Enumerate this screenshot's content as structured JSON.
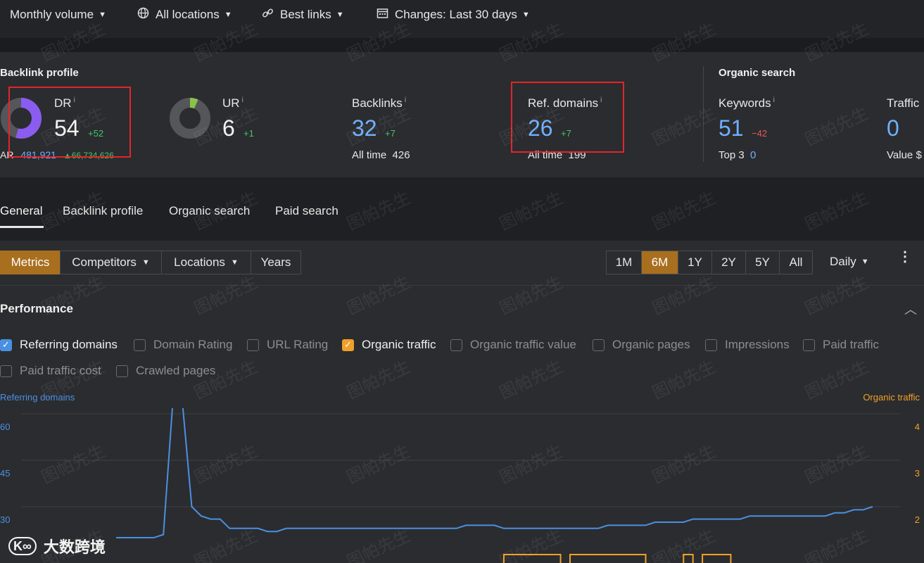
{
  "topbar": {
    "items": [
      {
        "label": "Monthly volume",
        "icon": ""
      },
      {
        "label": "All locations",
        "icon": "globe-icon"
      },
      {
        "label": "Best links",
        "icon": "link-icon"
      },
      {
        "label": "Changes: Last 30 days",
        "icon": "calendar-icon"
      }
    ]
  },
  "backlink_profile": {
    "title": "Backlink profile",
    "dr": {
      "label": "DR",
      "value": "54",
      "delta": "+52",
      "ar_label": "AR",
      "ar_value": "481,921",
      "ar_delta": "▲66,734,626"
    },
    "ur": {
      "label": "UR",
      "value": "6",
      "delta": "+1"
    },
    "backlinks": {
      "label": "Backlinks",
      "value": "32",
      "delta": "+7",
      "sub_label": "All time",
      "sub_value": "426"
    },
    "ref_domains": {
      "label": "Ref. domains",
      "value": "26",
      "delta": "+7",
      "sub_label": "All time",
      "sub_value": "199"
    }
  },
  "organic_search": {
    "title": "Organic search",
    "keywords": {
      "label": "Keywords",
      "value": "51",
      "delta": "−42",
      "sub_label": "Top 3",
      "sub_value": "0"
    },
    "traffic": {
      "label": "Traffic",
      "value": "0",
      "sub_label": "Value",
      "sub_value": "$"
    }
  },
  "tabs": [
    "General",
    "Backlink profile",
    "Organic search",
    "Paid search"
  ],
  "controls": {
    "metrics": "Metrics",
    "competitors": "Competitors",
    "locations": "Locations",
    "years": "Years",
    "ranges": [
      "1M",
      "6M",
      "1Y",
      "2Y",
      "5Y",
      "All"
    ],
    "active_range": "6M",
    "interval": "Daily"
  },
  "performance": {
    "title": "Performance",
    "checkboxes": [
      {
        "label": "Referring domains",
        "checked": true,
        "color": "#4a90e2"
      },
      {
        "label": "Domain Rating",
        "checked": false
      },
      {
        "label": "URL Rating",
        "checked": false
      },
      {
        "label": "Organic traffic",
        "checked": true,
        "color": "#f0a028"
      },
      {
        "label": "Organic traffic value",
        "checked": false
      },
      {
        "label": "Organic pages",
        "checked": false
      },
      {
        "label": "Impressions",
        "checked": false
      },
      {
        "label": "Paid traffic",
        "checked": false
      },
      {
        "label": "Paid traffic cost",
        "checked": false
      },
      {
        "label": "Crawled pages",
        "checked": false
      }
    ]
  },
  "chart_data": {
    "type": "line",
    "left_axis_title": "Referring domains",
    "right_axis_title": "Organic traffic",
    "left_ticks": [
      "60",
      "45",
      "30"
    ],
    "right_ticks": [
      "4",
      "3",
      "2"
    ],
    "series": [
      {
        "name": "Referring domains",
        "color": "#4a90e2",
        "values": [
          20,
          20,
          20,
          20,
          20,
          21,
          64,
          64,
          30,
          27,
          26,
          26,
          23,
          23,
          23,
          23,
          22,
          22,
          23,
          23,
          23,
          23,
          23,
          23,
          23,
          23,
          23,
          23,
          23,
          23,
          23,
          23,
          23,
          23,
          23,
          23,
          23,
          24,
          24,
          24,
          24,
          23,
          23,
          23,
          23,
          23,
          23,
          23,
          23,
          23,
          23,
          23,
          24,
          24,
          24,
          24,
          24,
          25,
          25,
          25,
          25,
          26,
          26,
          26,
          26,
          26,
          26,
          27,
          27,
          27,
          27,
          27,
          27,
          27,
          27,
          27,
          28,
          28,
          29,
          29,
          30
        ]
      },
      {
        "name": "Organic traffic",
        "color": "#f0a028",
        "values": [
          0,
          0,
          0,
          0,
          0,
          0,
          0,
          0,
          0,
          0,
          0,
          0,
          0,
          0,
          0,
          0,
          0,
          0,
          0,
          0,
          0,
          0,
          0,
          0,
          0,
          0,
          0,
          0,
          0,
          0,
          0,
          0,
          0,
          0,
          0,
          0,
          0,
          0,
          0,
          0,
          0,
          1,
          1,
          1,
          1,
          1,
          1,
          0,
          1,
          1,
          1,
          1,
          1,
          1,
          1,
          1,
          0,
          0,
          0,
          0,
          1,
          0,
          1,
          1,
          1,
          0,
          0,
          0,
          0,
          0,
          0,
          0,
          0,
          0,
          0,
          0,
          0,
          0,
          0,
          0,
          0
        ]
      }
    ],
    "left_ylim": [
      15,
      67
    ],
    "right_ylim": [
      0,
      4
    ],
    "grid": true
  },
  "watermark": "图帕先生",
  "brand": {
    "logo": "K∞",
    "name": "大数跨境"
  }
}
